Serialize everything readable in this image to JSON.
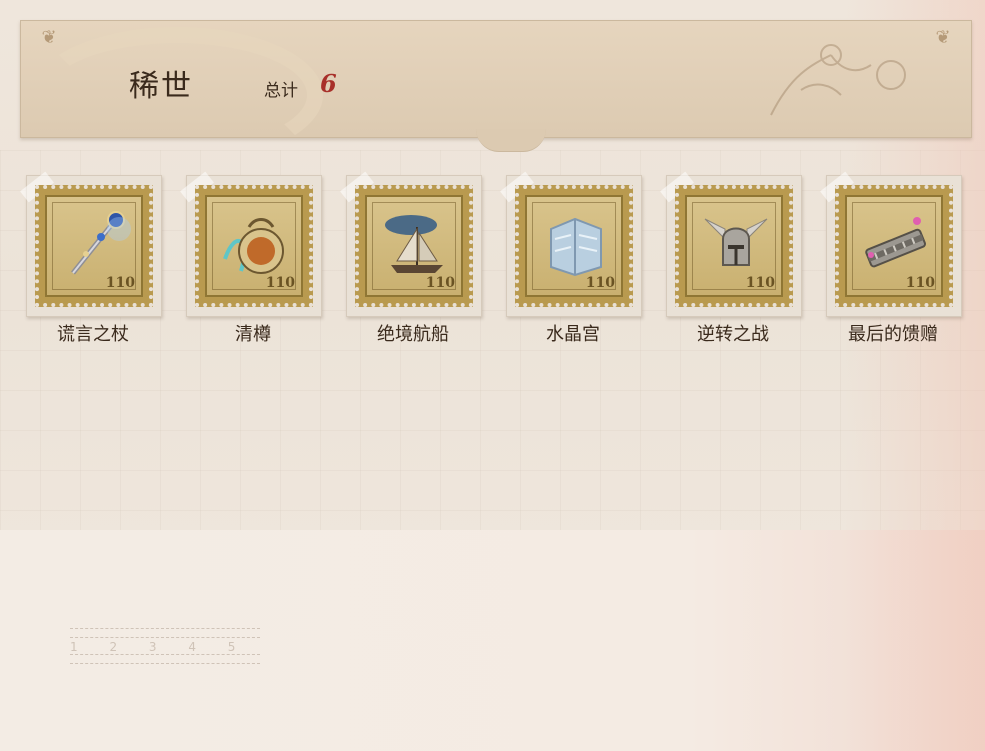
{
  "header": {
    "title": "稀世",
    "total_label": "总计",
    "total_value": "6",
    "corner_icon": "flourish-corner-icon"
  },
  "items": [
    {
      "label": "谎言之杖",
      "icon": "scepter-icon",
      "stamp_value": "110"
    },
    {
      "label": "清樽",
      "icon": "wine-vessel-icon",
      "stamp_value": "110"
    },
    {
      "label": "绝境航船",
      "icon": "sailing-ship-icon",
      "stamp_value": "110"
    },
    {
      "label": "水晶宫",
      "icon": "crystal-palace-icon",
      "stamp_value": "110"
    },
    {
      "label": "逆转之战",
      "icon": "winged-helmet-icon",
      "stamp_value": "110"
    },
    {
      "label": "最后的馈赠",
      "icon": "harmonica-icon",
      "stamp_value": "110"
    }
  ],
  "ruler": {
    "digits": "1 2 3 4 5"
  },
  "colors": {
    "total_value": "#a8302a",
    "stamp_gold": "#b99a4f",
    "text_dark": "#3a2a1c"
  }
}
